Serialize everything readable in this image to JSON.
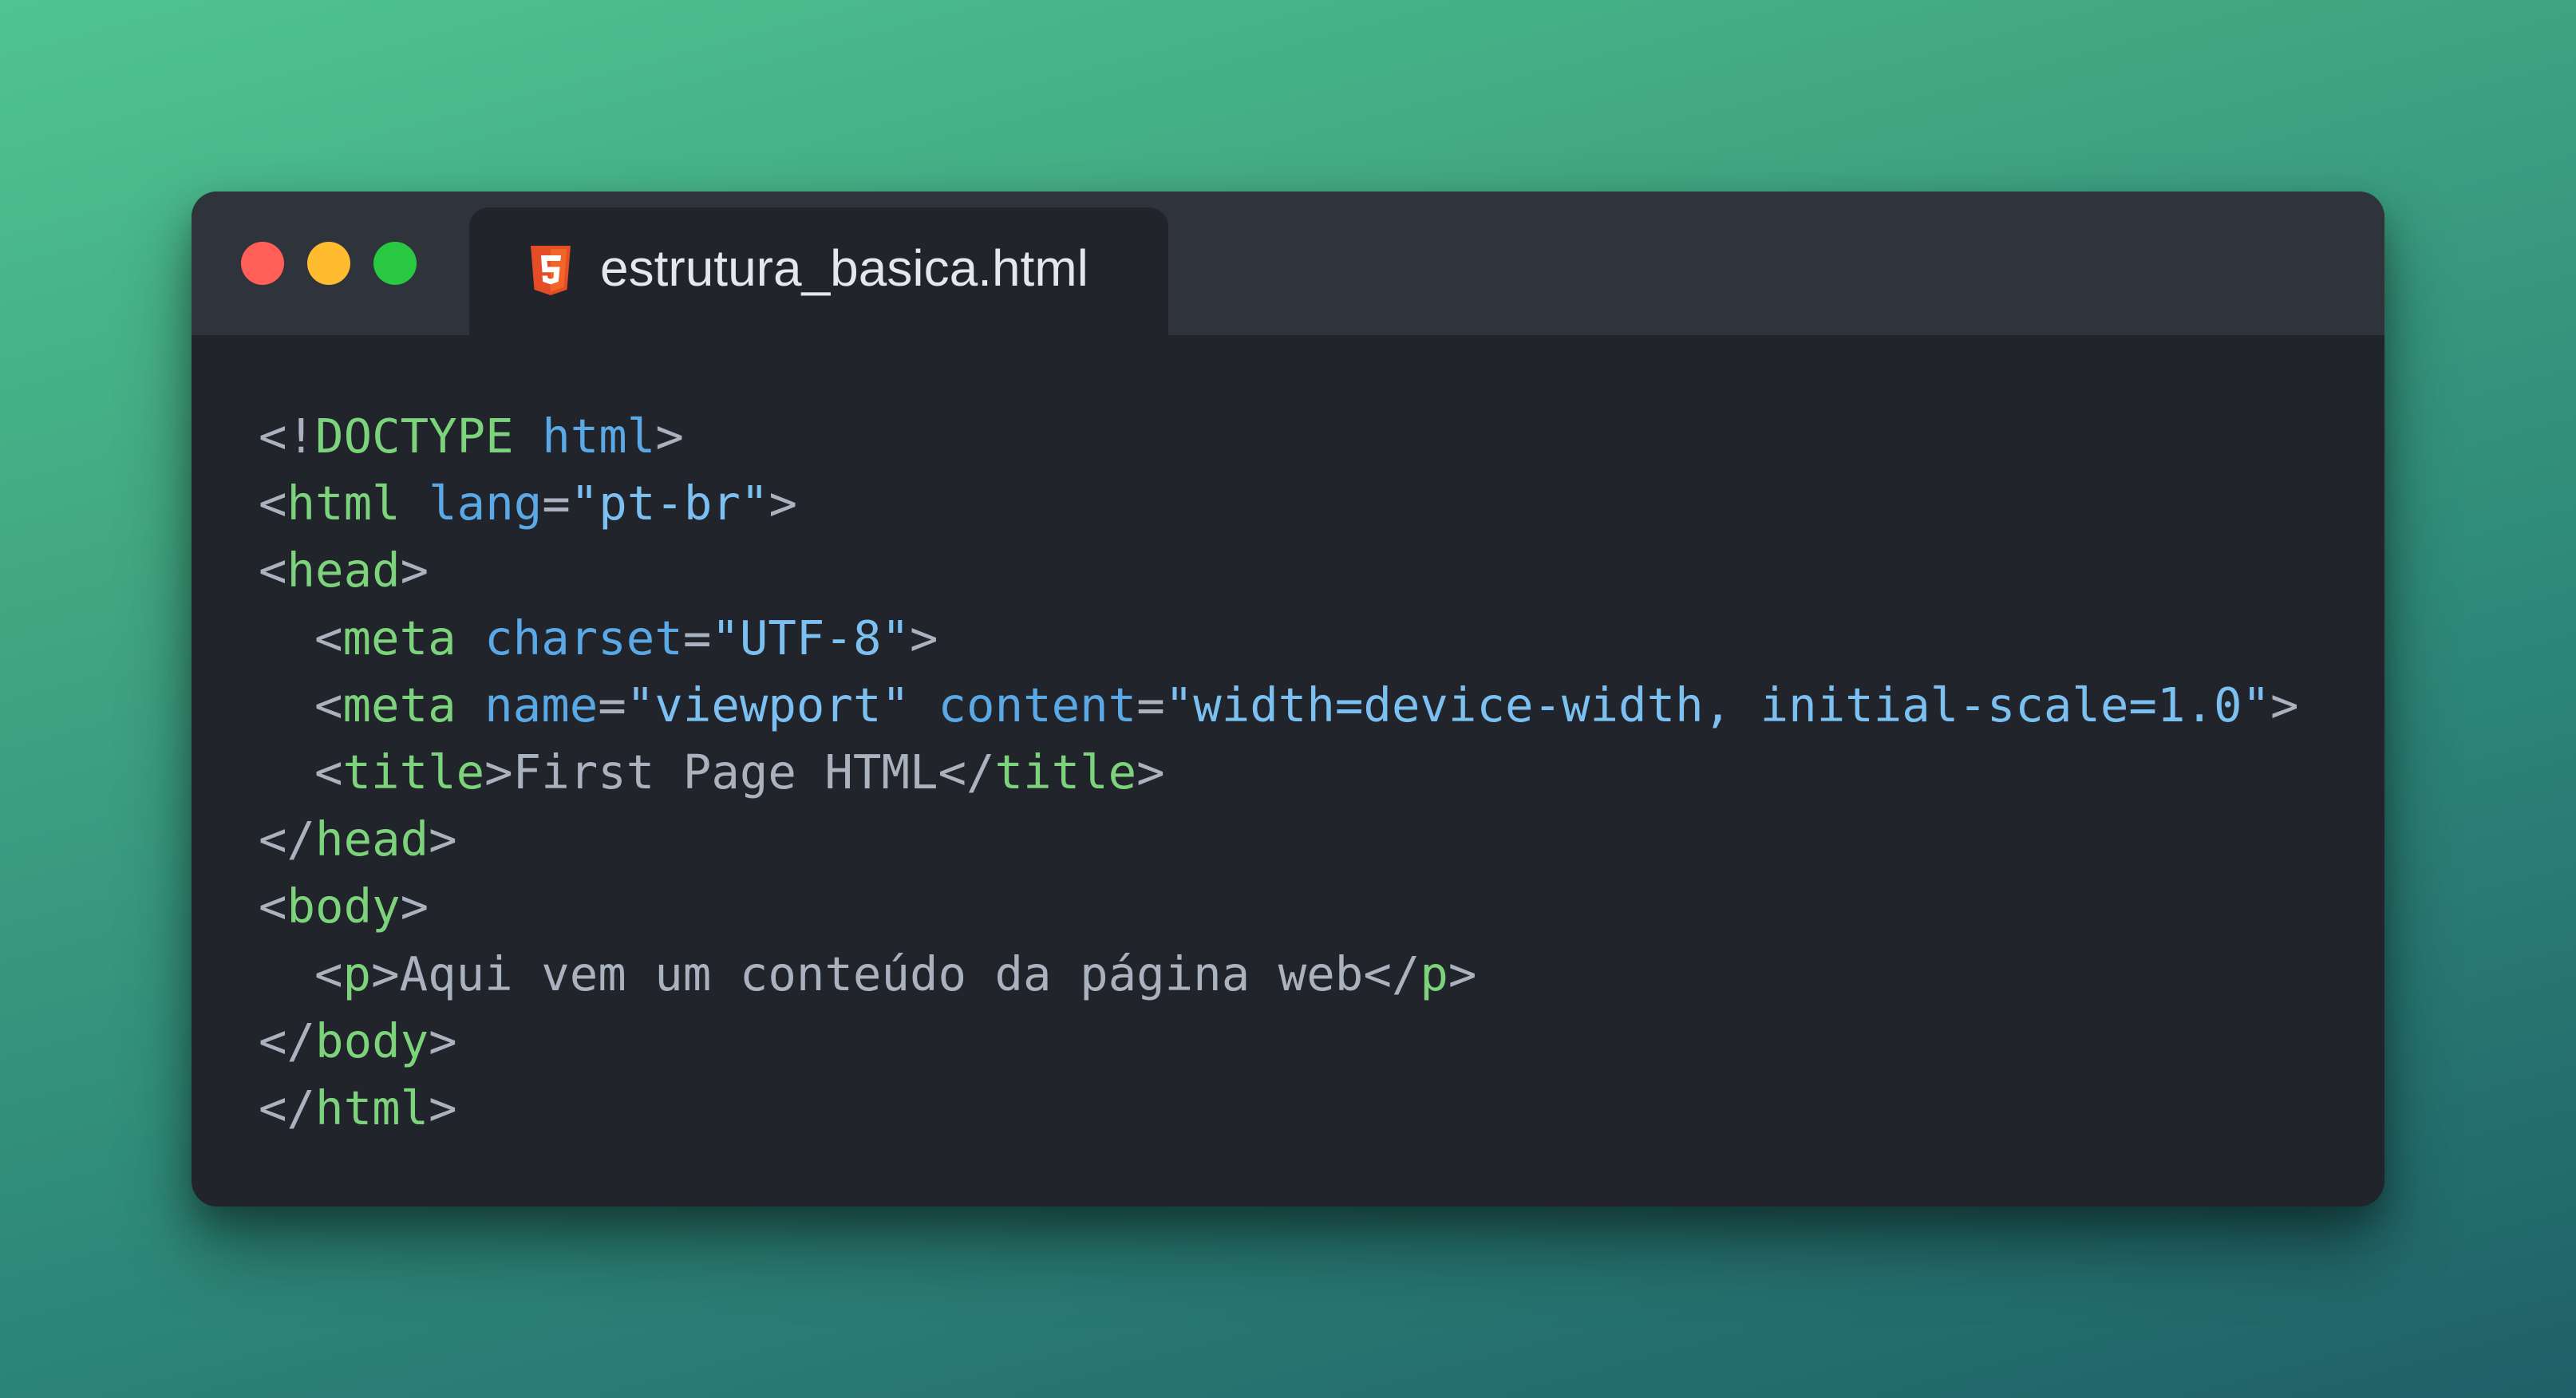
{
  "window": {
    "tab": {
      "filename": "estrutura_basica.html",
      "icon": "html5-icon"
    }
  },
  "colors": {
    "background_top": "#4fc490",
    "background_bottom": "#1f6068",
    "window_bg": "#21252b",
    "titlebar_bg": "#2f333c",
    "tag": "#7dd37b",
    "attribute": "#5aa9e6",
    "string": "#7cc0f2",
    "punctuation": "#abb2bf",
    "html5_icon": "#e44d26"
  },
  "code": {
    "lines": [
      [
        {
          "k": "p",
          "v": "<!"
        },
        {
          "k": "t",
          "v": "DOCTYPE"
        },
        {
          "k": "p",
          "v": " "
        },
        {
          "k": "a",
          "v": "html"
        },
        {
          "k": "p",
          "v": ">"
        }
      ],
      [
        {
          "k": "p",
          "v": "<"
        },
        {
          "k": "t",
          "v": "html"
        },
        {
          "k": "p",
          "v": " "
        },
        {
          "k": "a",
          "v": "lang"
        },
        {
          "k": "p",
          "v": "="
        },
        {
          "k": "s",
          "v": "\"pt-br\""
        },
        {
          "k": "p",
          "v": ">"
        }
      ],
      [
        {
          "k": "p",
          "v": "<"
        },
        {
          "k": "t",
          "v": "head"
        },
        {
          "k": "p",
          "v": ">"
        }
      ],
      [
        {
          "k": "i",
          "v": ""
        },
        {
          "k": "p",
          "v": "<"
        },
        {
          "k": "t",
          "v": "meta"
        },
        {
          "k": "p",
          "v": " "
        },
        {
          "k": "a",
          "v": "charset"
        },
        {
          "k": "p",
          "v": "="
        },
        {
          "k": "s",
          "v": "\"UTF-8\""
        },
        {
          "k": "p",
          "v": ">"
        }
      ],
      [
        {
          "k": "i",
          "v": ""
        },
        {
          "k": "p",
          "v": "<"
        },
        {
          "k": "t",
          "v": "meta"
        },
        {
          "k": "p",
          "v": " "
        },
        {
          "k": "a",
          "v": "name"
        },
        {
          "k": "p",
          "v": "="
        },
        {
          "k": "s",
          "v": "\"viewport\""
        },
        {
          "k": "p",
          "v": " "
        },
        {
          "k": "a",
          "v": "content"
        },
        {
          "k": "p",
          "v": "="
        },
        {
          "k": "s",
          "v": "\"width=device-width, initial-scale=1.0\""
        },
        {
          "k": "p",
          "v": ">"
        }
      ],
      [
        {
          "k": "i",
          "v": ""
        },
        {
          "k": "p",
          "v": "<"
        },
        {
          "k": "t",
          "v": "title"
        },
        {
          "k": "p",
          "v": ">"
        },
        {
          "k": "x",
          "v": "First Page HTML"
        },
        {
          "k": "p",
          "v": "</"
        },
        {
          "k": "t",
          "v": "title"
        },
        {
          "k": "p",
          "v": ">"
        }
      ],
      [
        {
          "k": "p",
          "v": "</"
        },
        {
          "k": "t",
          "v": "head"
        },
        {
          "k": "p",
          "v": ">"
        }
      ],
      [
        {
          "k": "p",
          "v": "<"
        },
        {
          "k": "t",
          "v": "body"
        },
        {
          "k": "p",
          "v": ">"
        }
      ],
      [
        {
          "k": "i",
          "v": ""
        },
        {
          "k": "p",
          "v": "<"
        },
        {
          "k": "t",
          "v": "p"
        },
        {
          "k": "p",
          "v": ">"
        },
        {
          "k": "x",
          "v": "Aqui vem um conteúdo da página web"
        },
        {
          "k": "p",
          "v": "</"
        },
        {
          "k": "t",
          "v": "p"
        },
        {
          "k": "p",
          "v": ">"
        }
      ],
      [
        {
          "k": "p",
          "v": "</"
        },
        {
          "k": "t",
          "v": "body"
        },
        {
          "k": "p",
          "v": ">"
        }
      ],
      [
        {
          "k": "p",
          "v": "</"
        },
        {
          "k": "t",
          "v": "html"
        },
        {
          "k": "p",
          "v": ">"
        }
      ]
    ]
  }
}
